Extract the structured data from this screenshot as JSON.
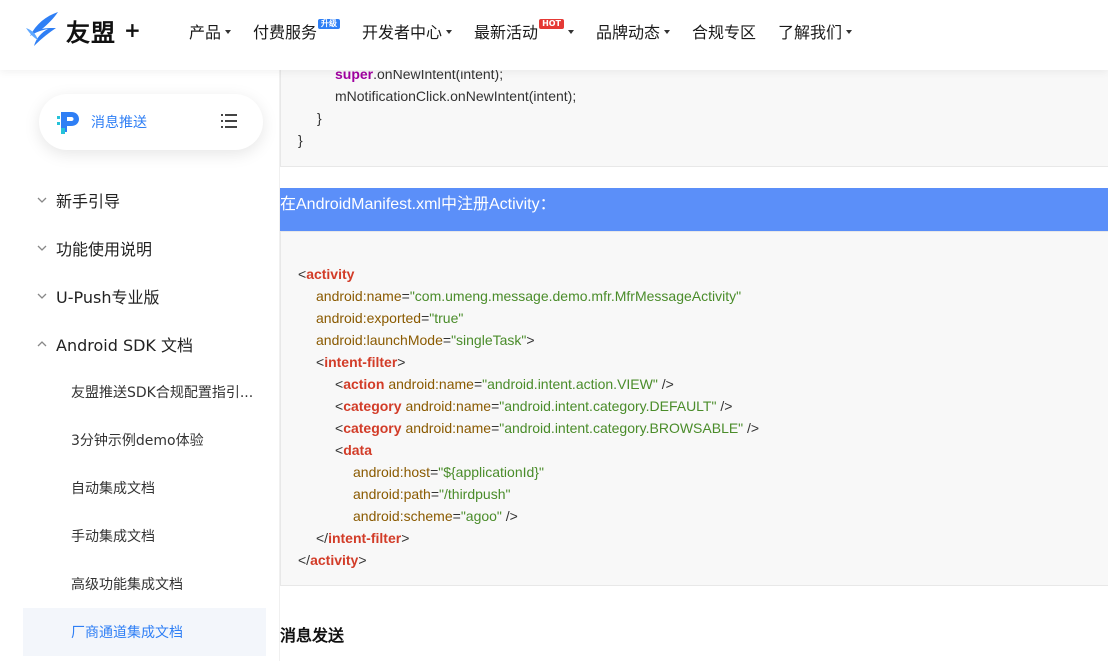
{
  "header": {
    "logo_text": "友盟",
    "logo_plus": "+",
    "nav": [
      {
        "label": "产品",
        "caret": true
      },
      {
        "label": "付费服务",
        "badge": "升级",
        "badge_color": "#2f7ff5"
      },
      {
        "label": "开发者中心",
        "caret": true
      },
      {
        "label": "最新活动",
        "badge": "HOT",
        "badge_color": "#e53935",
        "caret": true
      },
      {
        "label": "品牌动态",
        "caret": true
      },
      {
        "label": "合规专区"
      },
      {
        "label": "了解我们",
        "caret": true
      }
    ]
  },
  "sidebar": {
    "product_label": "消息推送",
    "menu": [
      {
        "label": "新手引导",
        "expanded": false
      },
      {
        "label": "功能使用说明",
        "expanded": false
      },
      {
        "label": "U-Push专业版",
        "expanded": false
      },
      {
        "label": "Android SDK 文档",
        "expanded": true
      }
    ],
    "sub_items": [
      {
        "label": "友盟推送SDK合规配置指引...",
        "active": false
      },
      {
        "label": "3分钟示例demo体验",
        "active": false
      },
      {
        "label": "自动集成文档",
        "active": false
      },
      {
        "label": "手动集成文档",
        "active": false
      },
      {
        "label": "高级功能集成文档",
        "active": false
      },
      {
        "label": "厂商通道集成文档",
        "active": true
      }
    ]
  },
  "content": {
    "code_top": {
      "line1_kw": "super",
      "line1_rest": ".onNewIntent(intent);",
      "line2": "mNotificationClick.onNewIntent(intent);",
      "line3": "}",
      "line4": "}"
    },
    "heading": "在AndroidManifest.xml中注册Activity：",
    "manifest": {
      "activity_tag": "activity",
      "name_attr": "android:name",
      "name_val": "\"com.umeng.message.demo.mfr.MfrMessageActivity\"",
      "exported_attr": "android:exported",
      "exported_val": "\"true\"",
      "launch_attr": "android:launchMode",
      "launch_val": "\"singleTask\"",
      "intent_filter_tag": "intent-filter",
      "action_tag": "action",
      "action_val": "\"android.intent.action.VIEW\"",
      "category_tag": "category",
      "category_default_val": "\"android.intent.category.DEFAULT\"",
      "category_browsable_val": "\"android.intent.category.BROWSABLE\"",
      "data_tag": "data",
      "host_attr": "android:host",
      "host_val": "\"${applicationId}\"",
      "path_attr": "android:path",
      "path_val": "\"/thirdpush\"",
      "scheme_attr": "android:scheme",
      "scheme_val": "\"agoo\""
    },
    "section_title": "消息发送"
  }
}
